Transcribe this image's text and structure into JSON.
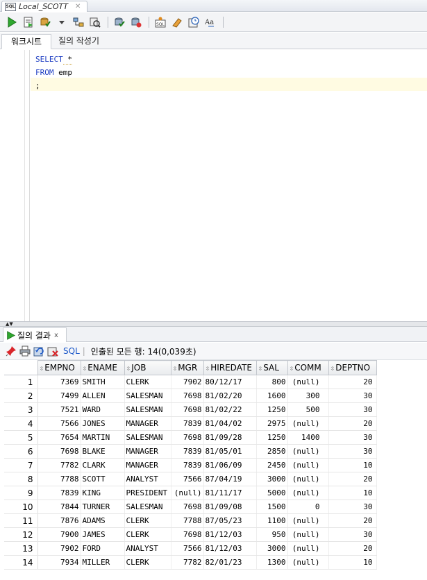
{
  "doc_tab": {
    "title": "Local_SCOTT",
    "icon": "sql-worksheet-icon"
  },
  "toolbar": {
    "icons": [
      "run-statement-icon",
      "run-script-icon",
      "commit-icon",
      "rollback-icon",
      "explain-plan-icon",
      "autotrace-icon",
      "sql-tuning-icon",
      "clear-icon",
      "format-icon",
      "history-icon",
      "text-case-icon"
    ]
  },
  "subtabs": {
    "worksheet": "워크시트",
    "query_builder": "질의 작성기"
  },
  "editor": {
    "lines": [
      {
        "kw": "SELECT",
        "rest": " *"
      },
      {
        "kw": "FROM",
        "rest": " emp"
      },
      {
        "kw": "",
        "rest": ";"
      }
    ]
  },
  "results": {
    "tab_label": "질의 결과",
    "tab_close": "x",
    "sql_link": "SQL",
    "status": "인출된 모든 행: 14(0,039초)",
    "columns": [
      "EMPNO",
      "ENAME",
      "JOB",
      "MGR",
      "HIREDATE",
      "SAL",
      "COMM",
      "DEPTNO"
    ],
    "rows": [
      [
        "1",
        "7369",
        "SMITH",
        "CLERK",
        "7902",
        "80/12/17",
        "800",
        "(null)",
        "20"
      ],
      [
        "2",
        "7499",
        "ALLEN",
        "SALESMAN",
        "7698",
        "81/02/20",
        "1600",
        "300",
        "30"
      ],
      [
        "3",
        "7521",
        "WARD",
        "SALESMAN",
        "7698",
        "81/02/22",
        "1250",
        "500",
        "30"
      ],
      [
        "4",
        "7566",
        "JONES",
        "MANAGER",
        "7839",
        "81/04/02",
        "2975",
        "(null)",
        "20"
      ],
      [
        "5",
        "7654",
        "MARTIN",
        "SALESMAN",
        "7698",
        "81/09/28",
        "1250",
        "1400",
        "30"
      ],
      [
        "6",
        "7698",
        "BLAKE",
        "MANAGER",
        "7839",
        "81/05/01",
        "2850",
        "(null)",
        "30"
      ],
      [
        "7",
        "7782",
        "CLARK",
        "MANAGER",
        "7839",
        "81/06/09",
        "2450",
        "(null)",
        "10"
      ],
      [
        "8",
        "7788",
        "SCOTT",
        "ANALYST",
        "7566",
        "87/04/19",
        "3000",
        "(null)",
        "20"
      ],
      [
        "9",
        "7839",
        "KING",
        "PRESIDENT",
        "(null)",
        "81/11/17",
        "5000",
        "(null)",
        "10"
      ],
      [
        "10",
        "7844",
        "TURNER",
        "SALESMAN",
        "7698",
        "81/09/08",
        "1500",
        "0",
        "30"
      ],
      [
        "11",
        "7876",
        "ADAMS",
        "CLERK",
        "7788",
        "87/05/23",
        "1100",
        "(null)",
        "20"
      ],
      [
        "12",
        "7900",
        "JAMES",
        "CLERK",
        "7698",
        "81/12/03",
        "950",
        "(null)",
        "30"
      ],
      [
        "13",
        "7902",
        "FORD",
        "ANALYST",
        "7566",
        "81/12/03",
        "3000",
        "(null)",
        "20"
      ],
      [
        "14",
        "7934",
        "MILLER",
        "CLERK",
        "7782",
        "82/01/23",
        "1300",
        "(null)",
        "10"
      ]
    ]
  }
}
